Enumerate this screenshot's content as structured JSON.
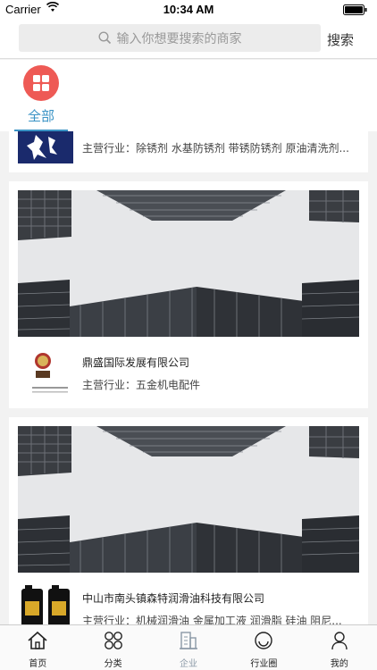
{
  "status": {
    "carrier": "Carrier",
    "time": "10:34 AM"
  },
  "search": {
    "placeholder": "输入你想要搜索的商家",
    "button": "搜索"
  },
  "categories": [
    {
      "label": "全部"
    }
  ],
  "companies": [
    {
      "name": "",
      "business": "主营行业：除锈剂 水基防锈剂 带锈防锈剂 原油清洗剂..."
    },
    {
      "name": "鼎盛国际发展有限公司",
      "business": "主营行业：五金机电配件",
      "logo_text": "鼎盛国际"
    },
    {
      "name": "中山市南头镇森特润滑油科技有限公司",
      "business": "主营行业：机械润滑油 金属加工液 润滑脂 硅油 阻尼..."
    }
  ],
  "tabbar": [
    {
      "label": "首页",
      "icon": "home-icon"
    },
    {
      "label": "分类",
      "icon": "category-icon"
    },
    {
      "label": "企业",
      "icon": "enterprise-icon",
      "active": true
    },
    {
      "label": "行业圈",
      "icon": "industry-circle-icon"
    },
    {
      "label": "我的",
      "icon": "profile-icon"
    }
  ]
}
